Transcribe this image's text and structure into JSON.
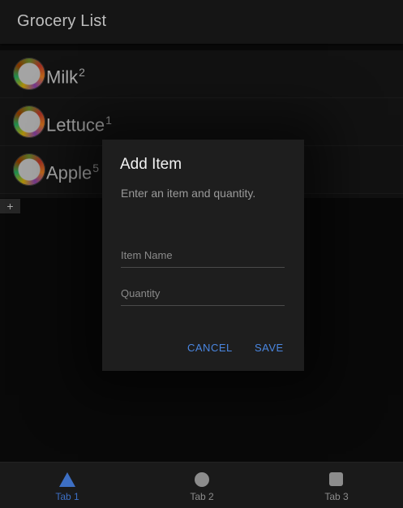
{
  "header": {
    "title": "Grocery List"
  },
  "list": {
    "items": [
      {
        "name": "Milk",
        "quantity": "2"
      },
      {
        "name": "Lettuce",
        "quantity": "1"
      },
      {
        "name": "Apple",
        "quantity": "5"
      }
    ]
  },
  "fab": {
    "label": "+"
  },
  "dialog": {
    "title": "Add Item",
    "message": "Enter an item and quantity.",
    "name_placeholder": "Item Name",
    "quantity_placeholder": "Quantity",
    "cancel_label": "CANCEL",
    "save_label": "SAVE"
  },
  "tabs": [
    {
      "label": "Tab 1",
      "icon": "triangle-icon",
      "active": true
    },
    {
      "label": "Tab 2",
      "icon": "circle-icon",
      "active": false
    },
    {
      "label": "Tab 3",
      "icon": "square-icon",
      "active": false
    }
  ],
  "colors": {
    "accent": "#3d6fc4",
    "button_text": "#4a86e0",
    "background": "#0c0c0c",
    "surface": "#1e1e1e"
  }
}
